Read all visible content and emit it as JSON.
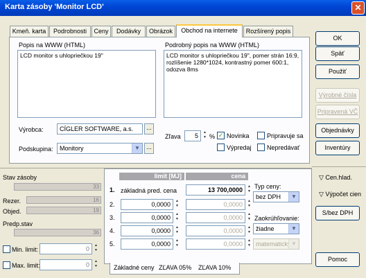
{
  "window": {
    "title": "Karta zásoby 'Monitor LCD'",
    "close": "✕"
  },
  "tabs": [
    "Kmeň. karta",
    "Podrobnosti",
    "Ceny",
    "Dodávky",
    "Obrázok",
    "Obchod na internete",
    "Rozšírený popis"
  ],
  "active_tab": "Obchod na internete",
  "web": {
    "popis_label": "Popis na WWW (HTML)",
    "popis_value": "LCD monitor s uhlopriečkou 19\"",
    "podrobny_label": "Podrobný popis na WWW (HTML)",
    "podrobny_value": "LCD monitor s uhlopriečkou 19\", pomer strán 16:9, rozlíšenie 1280*1024, kontrastný pomer 600:1, odozva 8ms",
    "vyrobca_label": "Výrobca:",
    "vyrobca_value": "CÍGLER SOFTWARE, a.s.",
    "podskupina_label": "Podskupina:",
    "podskupina_value": "Monitory",
    "zlava_label": "Zľava",
    "zlava_value": "5",
    "zlava_unit": "%",
    "novinka": "Novinka",
    "pripravuje": "Pripravuje sa",
    "vypredaj": "Výpredaj",
    "nepredavat": "Nepredávať",
    "ellipsis": "..."
  },
  "sidebar": {
    "ok": "OK",
    "spat": "Späť",
    "pouzit": "Použiť",
    "vyrobne": "Výrobné čísla",
    "pripravena": "Pripravená VČ",
    "objednavky": "Objednávky",
    "inventury": "Inventúry",
    "cen_hlad": "Cen.hlad.",
    "vypocet": "Výpočet cien",
    "s_bez": "S/bez DPH",
    "pomoc": "Pomoc"
  },
  "stav": {
    "title": "Stav zásoby",
    "stav_value": "33",
    "rezer_label": "Rezer.",
    "rezer_value": "16",
    "objed_label": "Objed.",
    "objed_value": "19",
    "predp_label": "Predp.stav",
    "predp_value": "36",
    "min_label": "Min. limit:",
    "min_value": "0",
    "max_label": "Max. limit:",
    "max_value": "0"
  },
  "prices": {
    "col_limit": "limit [MJ]",
    "col_cena": "cena",
    "rows": [
      {
        "n": "1.",
        "limit": "základná pred. cena",
        "cena": "13 700,0000"
      },
      {
        "n": "2.",
        "limit": "0,0000",
        "cena": "0,0000"
      },
      {
        "n": "3.",
        "limit": "0,0000",
        "cena": "0,0000"
      },
      {
        "n": "4.",
        "limit": "0,0000",
        "cena": "0,0000"
      },
      {
        "n": "5.",
        "limit": "0,0000",
        "cena": "0,0000"
      }
    ],
    "typ_label": "Typ ceny:",
    "typ_value": "bez DPH",
    "zaokr_label": "Zaokrúhľovanie:",
    "zaokr_value": "žiadne",
    "zaokr_method": "matematicky"
  },
  "bottom_tabs": [
    "Základné ceny",
    "ZĽAVA 05%",
    "ZĽAVA 10%"
  ]
}
